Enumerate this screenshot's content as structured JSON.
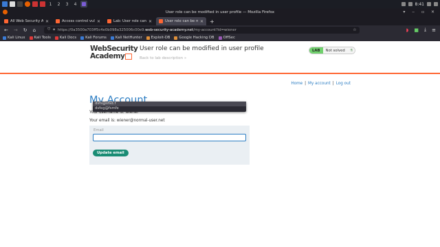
{
  "taskbar": {
    "workspaces": [
      "1",
      "2",
      "3",
      "4"
    ],
    "clock": "8:41"
  },
  "window": {
    "title": "User role can be modified in user profile — Mozilla Firefox"
  },
  "tabs": [
    {
      "label": "All Web Security Academ",
      "active": false
    },
    {
      "label": "Access control vulnerabil",
      "active": false
    },
    {
      "label": "Lab: User role can be mo",
      "active": false
    },
    {
      "label": "User role can be modifie",
      "active": true
    }
  ],
  "urlbar": {
    "url_prefix": "https://0a3500a703ff5c4e0b098a325006c00e9.",
    "host": "web-security-academy.net",
    "path": "/my-account?id=wiener"
  },
  "bookmarks": [
    {
      "label": "Kali Linux",
      "color": "#3a7bd5"
    },
    {
      "label": "Kali Tools",
      "color": "#e03a3a"
    },
    {
      "label": "Kali Docs",
      "color": "#e03a3a"
    },
    {
      "label": "Kali Forums",
      "color": "#3a7bd5"
    },
    {
      "label": "Kali NetHunter",
      "color": "#3a7bd5"
    },
    {
      "label": "Exploit-DB",
      "color": "#e0903a"
    },
    {
      "label": "Google Hacking DB",
      "color": "#e0903a"
    },
    {
      "label": "OffSec",
      "color": "#9b59b6"
    }
  ],
  "header": {
    "logo_line1": "WebSecurity",
    "logo_line2": "Academy",
    "lab_title": "User role can be modified in user profile",
    "back_link": "Back to lab description",
    "lab_badge": "LAB",
    "lab_status": "Not solved"
  },
  "nav": {
    "home": "Home",
    "sep1": "|",
    "my_account": "My account",
    "sep2": "|",
    "logout": "Log out"
  },
  "account": {
    "heading": "My Account",
    "username_line": "Your username is: wiener",
    "email_line": "Your email is: wiener@normal-user.net"
  },
  "form": {
    "email_label": "Email",
    "email_value": "",
    "submit_label": "Update email"
  },
  "autocomplete": {
    "items": [
      "dsfs@sfsd.f",
      "dsfeg@fsmfe"
    ]
  },
  "colors": {
    "accent_blue": "#2a7cc2",
    "brand_orange": "#ff6633",
    "button_green": "#1a8c74",
    "lab_green": "#70d16d"
  }
}
